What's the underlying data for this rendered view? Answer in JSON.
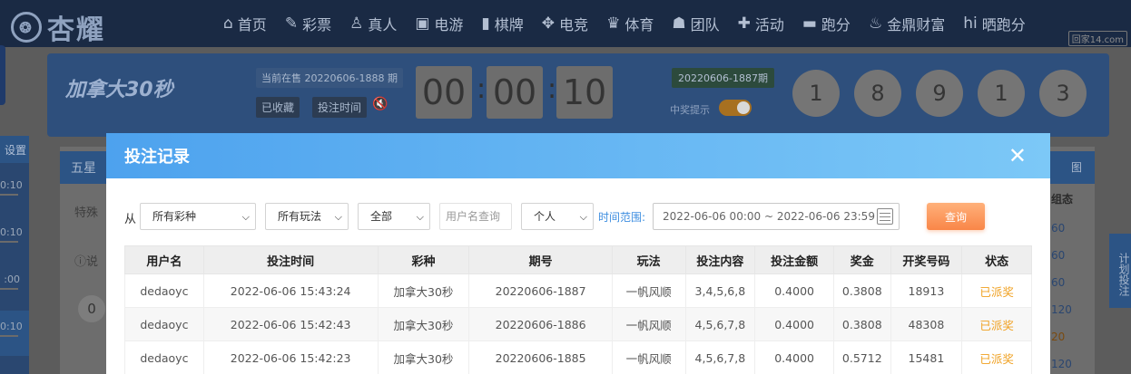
{
  "brand": {
    "name": "杏耀"
  },
  "nav": [
    {
      "label": "首页",
      "icon": "home-icon",
      "glyph": "⌂"
    },
    {
      "label": "彩票",
      "icon": "ticket-icon",
      "glyph": "✎"
    },
    {
      "label": "真人",
      "icon": "person-icon",
      "glyph": "♙"
    },
    {
      "label": "电游",
      "icon": "slot-icon",
      "glyph": "▣"
    },
    {
      "label": "棋牌",
      "icon": "cards-icon",
      "glyph": "▮"
    },
    {
      "label": "电竞",
      "icon": "gamepad-icon",
      "glyph": "✥"
    },
    {
      "label": "体育",
      "icon": "trophy-icon",
      "glyph": "♛"
    },
    {
      "label": "团队",
      "icon": "team-icon",
      "glyph": "☗"
    },
    {
      "label": "活动",
      "icon": "gift-icon",
      "glyph": "✚"
    },
    {
      "label": "跑分",
      "icon": "car-icon",
      "glyph": "▬"
    },
    {
      "label": "金鼎财富",
      "icon": "wealth-icon",
      "glyph": "♨"
    },
    {
      "label": "晒跑分",
      "icon": "share-icon",
      "glyph": "hi"
    }
  ],
  "watermark": "回家14.com",
  "game": {
    "logo": "加拿大30秒",
    "current_period": "当前在售 20220606-1888 期",
    "favorited": "已收藏",
    "bet_time": "投注时间",
    "timer": [
      "00",
      "00",
      "10"
    ],
    "prev_period": "20220606-1887期",
    "prize_tip": "中奖提示",
    "balls": [
      "1",
      "8",
      "9",
      "1",
      "3"
    ]
  },
  "background": {
    "side_tab": "设置",
    "side_rows": [
      "0:10",
      "0:10",
      ":00",
      "0:10"
    ],
    "tab_five": "五星",
    "special": "特殊",
    "explain": "说",
    "zero": "0",
    "right_head": "图",
    "right_label": "组态",
    "right_nums": [
      "60",
      "60",
      "60",
      "120",
      "20",
      "120"
    ],
    "float_label": "计划投注"
  },
  "modal": {
    "title": "投注记录",
    "from_label": "从",
    "lottery_select": "所有彩种",
    "play_select": "所有玩法",
    "status_select": "全部",
    "username_placeholder": "用户名查询",
    "scope_select": "个人",
    "range_label": "时间范围:",
    "range_value": "2022-06-06 00:00 ~ 2022-06-06 23:59",
    "query_label": "查询",
    "columns": [
      "用户名",
      "投注时间",
      "彩种",
      "期号",
      "玩法",
      "投注内容",
      "投注金额",
      "奖金",
      "开奖号码",
      "状态"
    ],
    "rows": [
      [
        "dedaoyc",
        "2022-06-06 15:43:24",
        "加拿大30秒",
        "20220606-1887",
        "一帆风顺",
        "3,4,5,6,8",
        "0.4000",
        "0.3808",
        "18913",
        "已派奖"
      ],
      [
        "dedaoyc",
        "2022-06-06 15:42:43",
        "加拿大30秒",
        "20220606-1886",
        "一帆风顺",
        "4,5,6,7,8",
        "0.4000",
        "0.3808",
        "48308",
        "已派奖"
      ],
      [
        "dedaoyc",
        "2022-06-06 15:42:23",
        "加拿大30秒",
        "20220606-1885",
        "一帆风顺",
        "4,5,6,7,8",
        "0.4000",
        "0.5712",
        "15481",
        "已派奖"
      ]
    ]
  },
  "colors": {
    "accent": "#4da2ee",
    "query": "#f98648",
    "status_paid": "#f0a020"
  }
}
